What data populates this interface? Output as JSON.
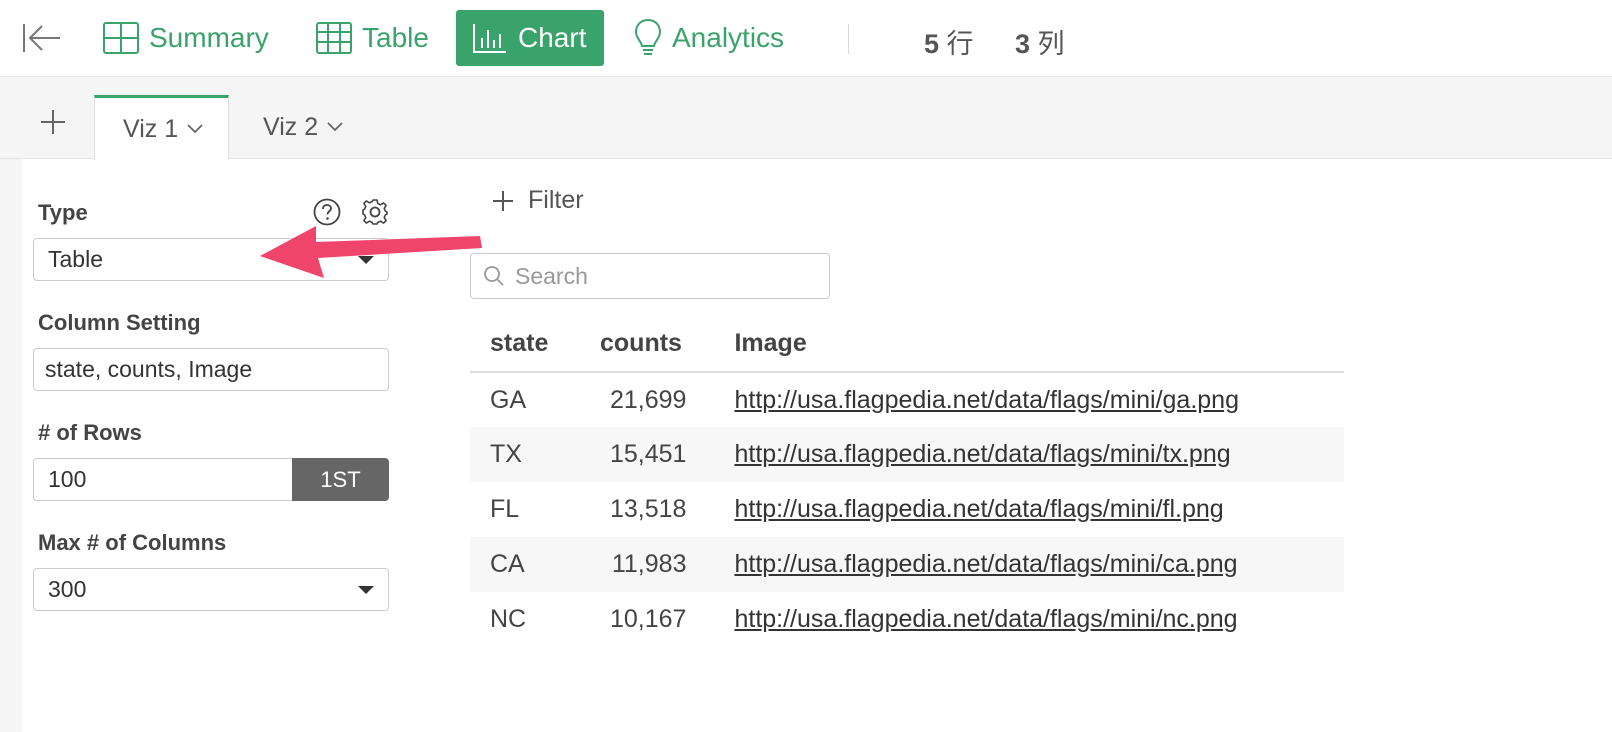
{
  "toolbar": {
    "nav": [
      {
        "label": "Summary",
        "icon": "summary-grid-icon"
      },
      {
        "label": "Table",
        "icon": "table-icon"
      },
      {
        "label": "Chart",
        "icon": "bar-chart-icon"
      },
      {
        "label": "Analytics",
        "icon": "lightbulb-icon"
      }
    ],
    "active_nav": "Chart",
    "rows_count": "5",
    "rows_unit": "行",
    "cols_count": "3",
    "cols_unit": "列"
  },
  "tabs": [
    {
      "label": "Viz 1",
      "active": true
    },
    {
      "label": "Viz 2",
      "active": false
    }
  ],
  "panel": {
    "type_label": "Type",
    "type_value": "Table",
    "column_setting_label": "Column Setting",
    "column_setting_value": "state, counts, Image",
    "rows_label": "# of Rows",
    "rows_value": "100",
    "rows_button": "1ST",
    "max_cols_label": "Max # of Columns",
    "max_cols_value": "300"
  },
  "main": {
    "filter_label": "Filter",
    "search_placeholder": "Search",
    "table": {
      "headers": [
        "state",
        "counts",
        "Image"
      ],
      "rows": [
        [
          "GA",
          "21,699",
          "http://usa.flagpedia.net/data/flags/mini/ga.png"
        ],
        [
          "TX",
          "15,451",
          "http://usa.flagpedia.net/data/flags/mini/tx.png"
        ],
        [
          "FL",
          "13,518",
          "http://usa.flagpedia.net/data/flags/mini/fl.png"
        ],
        [
          "CA",
          "11,983",
          "http://usa.flagpedia.net/data/flags/mini/ca.png"
        ],
        [
          "NC",
          "10,167",
          "http://usa.flagpedia.net/data/flags/mini/nc.png"
        ]
      ]
    }
  },
  "colors": {
    "accent_green": "#3aa36b",
    "annotation_arrow": "#f0456b"
  }
}
